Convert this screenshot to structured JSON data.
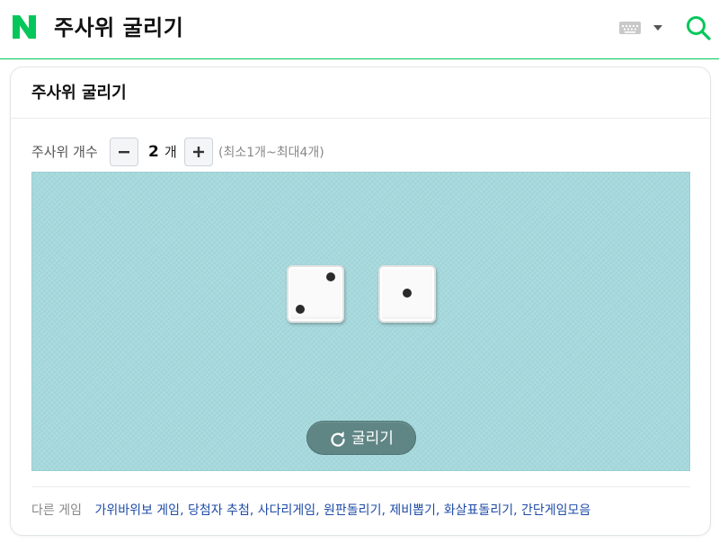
{
  "header": {
    "logo_letter": "N",
    "query": "주사위 굴리기",
    "brand_color": "#03c75a",
    "icons": [
      "naver-logo-icon",
      "keyboard-icon",
      "chevron-down-icon",
      "search-icon"
    ]
  },
  "card": {
    "title": "주사위 굴리기",
    "count_label": "주사위 개수",
    "count_value": "2",
    "count_unit": "개",
    "count_hint": "(최소1개~최대4개)",
    "dice": [
      {
        "face": 2
      },
      {
        "face": 1
      }
    ],
    "roll_label": "굴리기",
    "board_color": "#a6d9dd",
    "roll_button_color": "#5f8585"
  },
  "footer": {
    "label": "다른 게임",
    "links": [
      "가위바위보 게임",
      "당첨자 추첨",
      "사다리게임",
      "원판돌리기",
      "제비뽑기",
      "화살표돌리기",
      "간단게임모음"
    ],
    "link_color": "#1f4ca6"
  }
}
